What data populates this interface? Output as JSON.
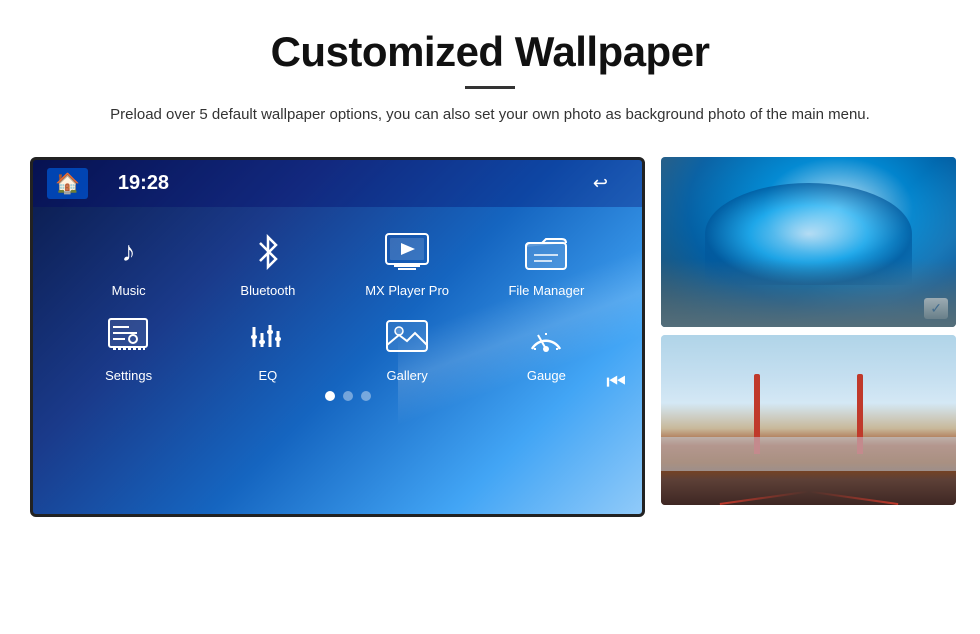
{
  "header": {
    "title": "Customized Wallpaper",
    "description": "Preload over 5 default wallpaper options, you can also set your own photo as background photo of the main menu."
  },
  "screen": {
    "time": "19:28",
    "apps_row1": [
      {
        "id": "music",
        "label": "Music",
        "icon": "♪"
      },
      {
        "id": "bluetooth",
        "label": "Bluetooth",
        "icon": "⊕"
      },
      {
        "id": "mx-player",
        "label": "MX Player Pro",
        "icon": "▦"
      },
      {
        "id": "file-manager",
        "label": "File Manager",
        "icon": "📁"
      }
    ],
    "apps_row2": [
      {
        "id": "settings",
        "label": "Settings",
        "icon": "⚙"
      },
      {
        "id": "eq",
        "label": "EQ",
        "icon": "⊞"
      },
      {
        "id": "gallery",
        "label": "Gallery",
        "icon": "▣"
      },
      {
        "id": "gauge",
        "label": "Gauge",
        "icon": "◉"
      }
    ],
    "dots": [
      {
        "active": true
      },
      {
        "active": false
      },
      {
        "active": false
      }
    ]
  },
  "thumbnails": [
    {
      "id": "ice-cave",
      "alt": "Ice cave wallpaper"
    },
    {
      "id": "golden-gate",
      "alt": "Golden Gate Bridge wallpaper"
    }
  ]
}
